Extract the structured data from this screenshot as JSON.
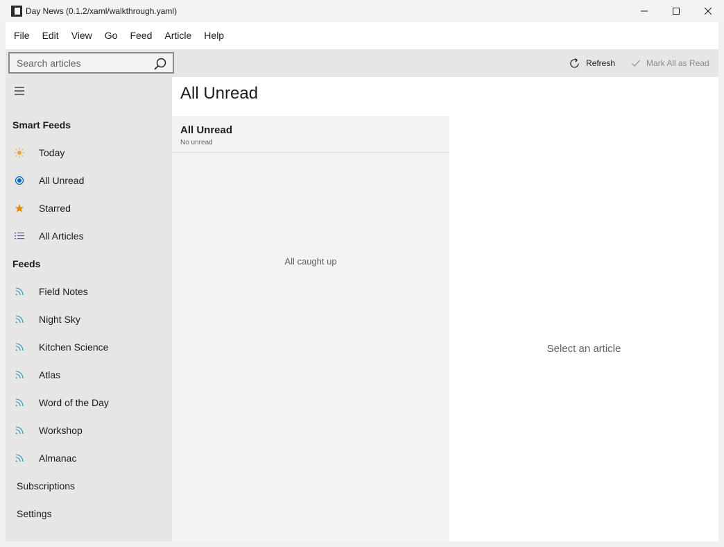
{
  "window": {
    "title": "Day News (0.1.2/xaml/walkthrough.yaml)"
  },
  "menu": [
    "File",
    "Edit",
    "View",
    "Go",
    "Feed",
    "Article",
    "Help"
  ],
  "search": {
    "placeholder": "Search articles",
    "value": ""
  },
  "toolbar": {
    "refresh_label": "Refresh",
    "mark_all_label": "Mark All as Read"
  },
  "sidebar": {
    "smart_feeds_header": "Smart Feeds",
    "smart_feeds": [
      {
        "label": "Today",
        "icon": "sun-icon"
      },
      {
        "label": "All Unread",
        "icon": "radio-dot-icon"
      },
      {
        "label": "Starred",
        "icon": "star-icon"
      },
      {
        "label": "All Articles",
        "icon": "list-icon"
      }
    ],
    "feeds_header": "Feeds",
    "feeds": [
      {
        "label": "Field Notes",
        "icon": "rss-icon"
      },
      {
        "label": "Night Sky",
        "icon": "rss-icon"
      },
      {
        "label": "Kitchen Science",
        "icon": "rss-icon"
      },
      {
        "label": "Atlas",
        "icon": "rss-icon"
      },
      {
        "label": "Word of the Day",
        "icon": "rss-icon"
      },
      {
        "label": "Workshop",
        "icon": "rss-icon"
      },
      {
        "label": "Almanac",
        "icon": "rss-icon"
      }
    ],
    "subscriptions_label": "Subscriptions",
    "settings_label": "Settings"
  },
  "main": {
    "page_title": "All Unread",
    "list_title": "All Unread",
    "list_subtitle": "No unread",
    "empty_message": "All caught up",
    "reader_placeholder": "Select an article"
  },
  "colors": {
    "accent_blue": "#0067c0",
    "sun_orange": "#f7a234",
    "star_orange": "#e88a0b",
    "list_purple": "#5a5adb",
    "rss_teal": "#2a8fb5"
  }
}
